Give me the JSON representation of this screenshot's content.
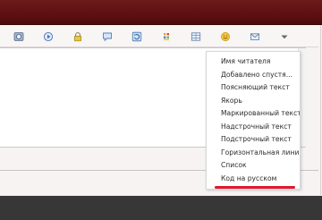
{
  "toolbar": {
    "buttons": [
      {
        "icon": "image-icon",
        "label": ""
      },
      {
        "icon": "media-play-icon",
        "label": ""
      },
      {
        "icon": "lock-icon",
        "label": ""
      },
      {
        "icon": "speech-bubble-icon",
        "label": ""
      },
      {
        "icon": "refresh-icon",
        "label": ""
      },
      {
        "icon": "color-grid-icon",
        "label": ""
      },
      {
        "icon": "table-icon",
        "label": ""
      },
      {
        "icon": "smiley-icon",
        "label": ""
      },
      {
        "icon": "envelope-icon",
        "label": ""
      },
      {
        "icon": "dropdown-arrow-icon",
        "label": ""
      }
    ]
  },
  "dropdown": {
    "items": [
      "Имя читателя",
      "Добавлено спустя...",
      "Поясняющий текст",
      "Якорь",
      "Маркированный текст",
      "Надстрочный текст",
      "Подстрочный текст",
      "Горизонтальная линия",
      "Список",
      "Код на русском"
    ]
  },
  "colors": {
    "header_bar": "#5a0f10",
    "highlight_underline": "#e0182e",
    "footer_bar": "#373737"
  }
}
